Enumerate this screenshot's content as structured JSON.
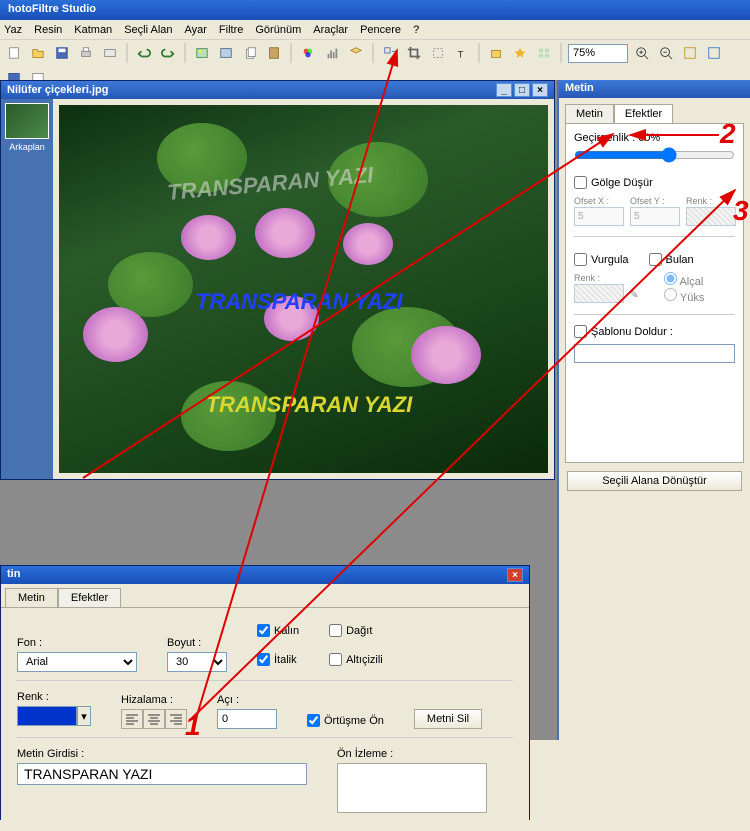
{
  "app": {
    "title": "hotoFiltre Studio"
  },
  "menu": [
    "Yaz",
    "Resin",
    "Katman",
    "Seçli Alan",
    "Ayar",
    "Filtre",
    "Görünüm",
    "Araçlar",
    "Pencere",
    "?"
  ],
  "zoom": "75%",
  "document": {
    "title": "Nilüfer çiçekleri.jpg",
    "thumb_label": "Arkaplan",
    "overlays": [
      "TRANSPARAN YAZI",
      "TRANSPARAN YAZI",
      "TRANSPARAN YAZI"
    ]
  },
  "rightPanel": {
    "title": "Metin",
    "tabs": [
      "Metin",
      "Efektler"
    ],
    "activeTab": 1,
    "opacity_label": "Geçirgenlik : 60%",
    "shadow_label": "Gölge Düşür",
    "offsetX": "Ofset X :",
    "offsetY": "Ofset Y :",
    "color": "Renk :",
    "offsetXval": "5",
    "offsetYval": "5",
    "highlight": "Vurgula",
    "bulan": "Bulan",
    "alcal": "Alçal",
    "yuks": "Yüks",
    "fillTemplate": "Şablonu Doldur :",
    "applySel": "Seçili Alana Dönüştür"
  },
  "dlg": {
    "title": "tin",
    "tabs": [
      "Metin",
      "Efektler"
    ],
    "activeTab": 0,
    "font_label": "Fon :",
    "font_value": "Arial",
    "size_label": "Boyut :",
    "size_value": "30",
    "bold": "Kalın",
    "italic": "İtalik",
    "scatter": "Dağıt",
    "underline": "Altıçizili",
    "color_label": "Renk :",
    "align_label": "Hizalama :",
    "angle_label": "Açı :",
    "angle_value": "0",
    "overlapFront": "Örtüşme Ön",
    "deleteText": "Metni Sil",
    "input_label": "Metin Girdisi :",
    "input_value": "TRANSPARAN YAZI",
    "preview_label": "Ön İzleme :"
  },
  "annotations": {
    "a1": "1",
    "a2": "2",
    "a3": "3"
  }
}
